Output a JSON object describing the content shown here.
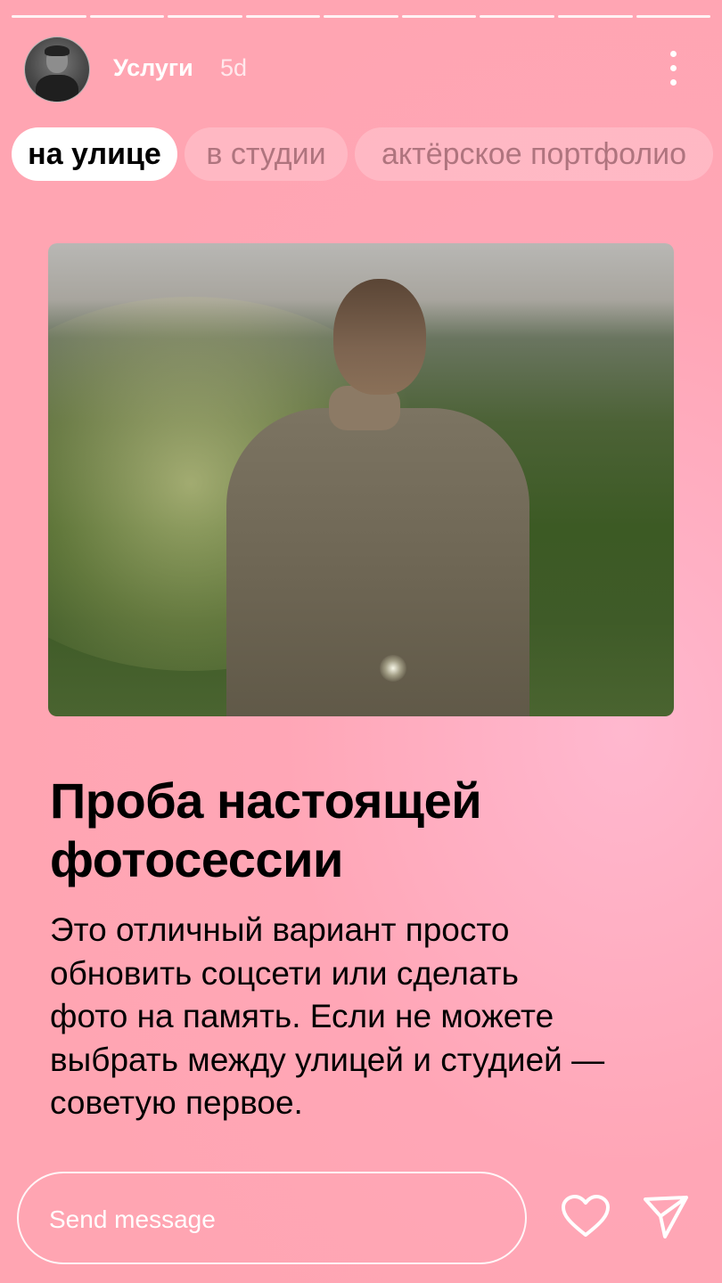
{
  "story": {
    "segments": 9
  },
  "header": {
    "username": "Услуги",
    "time": "5d"
  },
  "tabs": [
    {
      "label": "на улице",
      "active": true
    },
    {
      "label": "в студии",
      "active": false
    },
    {
      "label": "актёрское портфолио",
      "active": false
    }
  ],
  "content": {
    "title_line1": "Проба настоящей",
    "title_line2": "фотосессии",
    "body_lines": [
      "Это отличный вариант просто",
      "обновить соцсети или сделать",
      "фото на память. Если не можете",
      "выбрать между улицей и студией —",
      "советую первое."
    ]
  },
  "footer": {
    "message_placeholder": "Send message"
  },
  "colors": {
    "background": "#ffa6b6",
    "accent_white": "#ffffff"
  }
}
